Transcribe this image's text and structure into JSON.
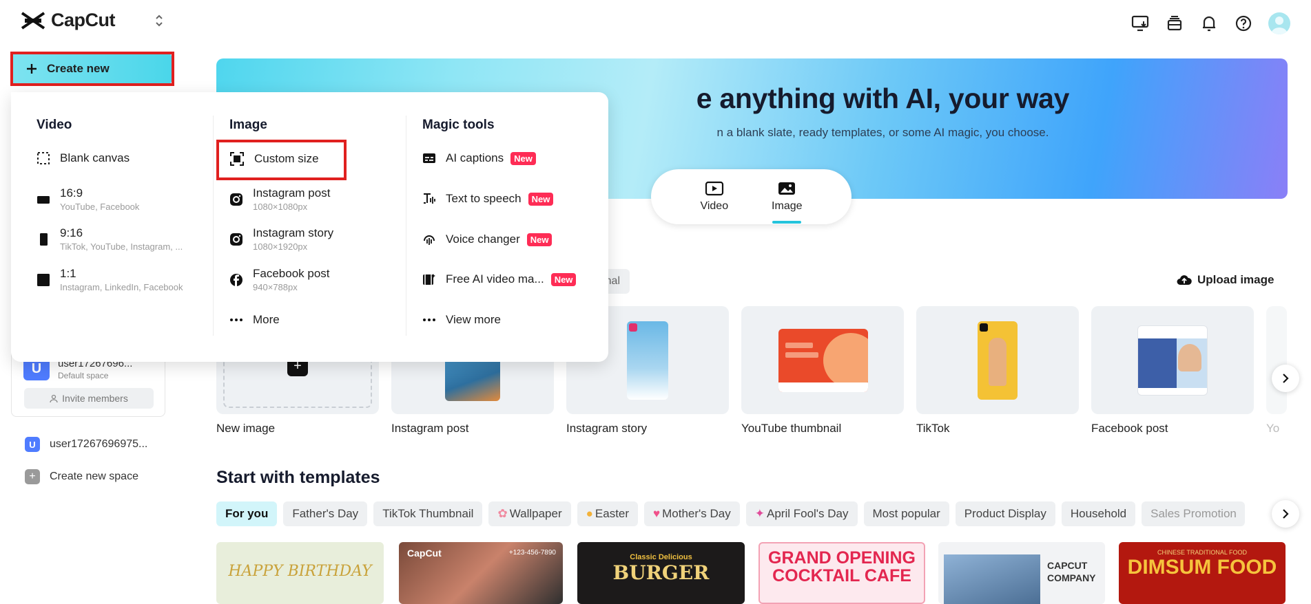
{
  "app": {
    "name": "CapCut"
  },
  "colors": {
    "accent": "#4ad6ea",
    "new_badge": "#fe2c55",
    "highlight": "#e0201f",
    "active_tab_underline": "#25c4dc"
  },
  "top_icons": [
    "desktop-download-icon",
    "storage-icon",
    "bell-icon",
    "help-icon",
    "avatar"
  ],
  "create_new": {
    "label": "Create new"
  },
  "dropdown": {
    "video": {
      "title": "Video",
      "items": [
        {
          "label": "Blank canvas",
          "sub": ""
        },
        {
          "label": "16:9",
          "sub": "YouTube, Facebook"
        },
        {
          "label": "9:16",
          "sub": "TikTok, YouTube, Instagram, ..."
        },
        {
          "label": "1:1",
          "sub": "Instagram, LinkedIn, Facebook"
        }
      ]
    },
    "image": {
      "title": "Image",
      "items": [
        {
          "label": "Custom size",
          "sub": ""
        },
        {
          "label": "Instagram post",
          "sub": "1080×1080px"
        },
        {
          "label": "Instagram story",
          "sub": "1080×1920px"
        },
        {
          "label": "Facebook post",
          "sub": "940×788px"
        },
        {
          "label": "More",
          "sub": ""
        }
      ]
    },
    "magic": {
      "title": "Magic tools",
      "badge": "New",
      "items": [
        {
          "label": "AI captions"
        },
        {
          "label": "Text to speech"
        },
        {
          "label": "Voice changer"
        },
        {
          "label": "Free AI video ma..."
        },
        {
          "label": "View more"
        }
      ]
    }
  },
  "hero": {
    "title_visible": "e anything with AI, your way",
    "subtitle_visible": "n a blank slate, ready templates, or some AI magic, you choose.",
    "modes": [
      {
        "label": "Video"
      },
      {
        "label": "Image",
        "active": true
      }
    ]
  },
  "filter_partial": "nal",
  "upload_label": "Upload image",
  "cards": [
    {
      "label": "New image"
    },
    {
      "label": "Instagram post"
    },
    {
      "label": "Instagram story"
    },
    {
      "label": "YouTube thumbnail"
    },
    {
      "label": "TikTok"
    },
    {
      "label": "Facebook post"
    },
    {
      "label": "Yo"
    }
  ],
  "sidebar": {
    "space_user": "user17267696...",
    "space_sub": "Default space",
    "invite": "Invite members",
    "user": "user17267696975...",
    "create_space": "Create new space",
    "badge_letter": "U"
  },
  "templates": {
    "title": "Start with templates",
    "tags": [
      "For you",
      "Father's Day",
      "TikTok Thumbnail",
      "Wallpaper",
      "Easter",
      "Mother's Day",
      "April Fool's Day",
      "Most popular",
      "Product Display",
      "Household",
      "Sales Promotion"
    ],
    "thumbs": [
      {
        "text": "HAPPY BIRTHDAY"
      },
      {
        "text": "CapCut",
        "sub": "+123-456-7890"
      },
      {
        "text": "BURGER",
        "sub": "Classic Delicious"
      },
      {
        "text": "GRAND OPENING",
        "sub": "COCKTAIL CAFE"
      },
      {
        "text": "CAPCUT",
        "sub": "COMPANY"
      },
      {
        "text": "DIMSUM FOOD",
        "sub": "CHINESE TRADITIONAL FOOD"
      }
    ]
  }
}
